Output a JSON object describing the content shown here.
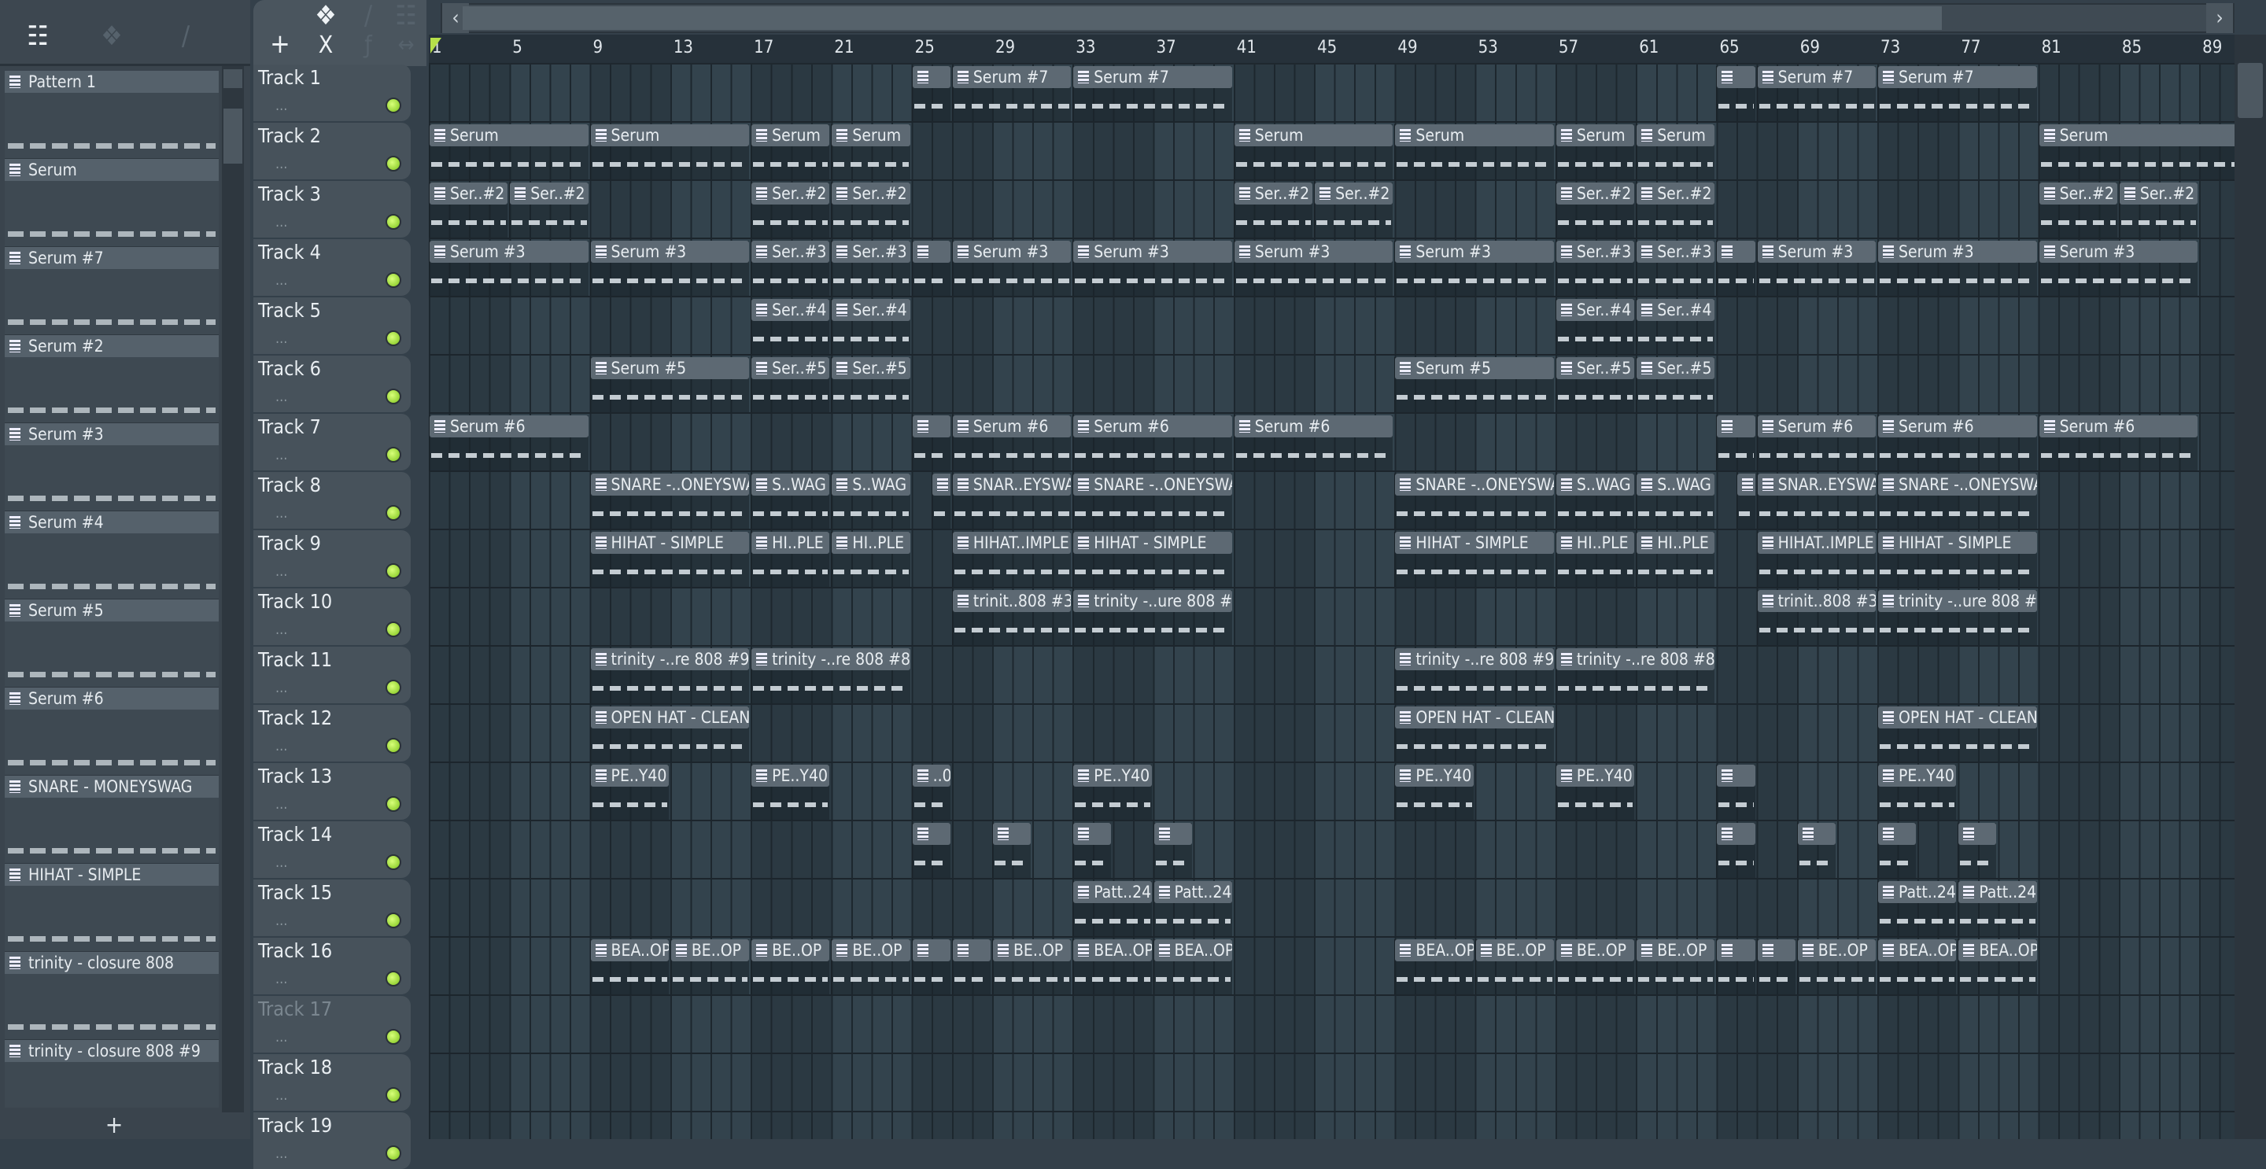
{
  "left_toolbar": {
    "icons": [
      "piano-roll-icon",
      "audio-wave-icon",
      "automation-icon"
    ]
  },
  "pattern_list": {
    "items": [
      "Pattern 1",
      "Serum",
      "Serum #7",
      "Serum #2",
      "Serum #3",
      "Serum #4",
      "Serum #5",
      "Serum #6",
      "SNARE - MONEYSWAG",
      "HIHAT - SIMPLE",
      "trinity - closure 808",
      "trinity - closure 808 #9"
    ],
    "add_label": "+"
  },
  "playlist_toolbar": {
    "add_label": "+",
    "x_label": "X",
    "f_label": "ƒ"
  },
  "ruler": {
    "bars": [
      "1",
      "5",
      "9",
      "13",
      "17",
      "21",
      "25",
      "29",
      "33",
      "37",
      "41",
      "45",
      "49",
      "53",
      "57",
      "61",
      "65",
      "69",
      "73",
      "77",
      "81",
      "85",
      "89"
    ]
  },
  "tracks": [
    {
      "name": "Track 1",
      "clips": [
        [
          25,
          2,
          ""
        ],
        [
          27,
          6,
          "Serum #7"
        ],
        [
          33,
          8,
          "Serum #7"
        ],
        [
          65,
          2,
          ""
        ],
        [
          67,
          6,
          "Serum #7"
        ],
        [
          73,
          8,
          "Serum #7"
        ]
      ]
    },
    {
      "name": "Track 2",
      "clips": [
        [
          1,
          8,
          "Serum"
        ],
        [
          9,
          8,
          "Serum"
        ],
        [
          17,
          4,
          "Serum"
        ],
        [
          21,
          4,
          "Serum"
        ],
        [
          41,
          8,
          "Serum"
        ],
        [
          49,
          8,
          "Serum"
        ],
        [
          57,
          4,
          "Serum"
        ],
        [
          61,
          4,
          "Serum"
        ],
        [
          81,
          10,
          "Serum"
        ]
      ]
    },
    {
      "name": "Track 3",
      "clips": [
        [
          1,
          4,
          "Ser..#2"
        ],
        [
          5,
          4,
          "Ser..#2"
        ],
        [
          17,
          4,
          "Ser..#2"
        ],
        [
          21,
          4,
          "Ser..#2"
        ],
        [
          41,
          4,
          "Ser..#2"
        ],
        [
          45,
          4,
          "Ser..#2"
        ],
        [
          57,
          4,
          "Ser..#2"
        ],
        [
          61,
          4,
          "Ser..#2"
        ],
        [
          81,
          4,
          "Ser..#2"
        ],
        [
          85,
          4,
          "Ser..#2"
        ]
      ]
    },
    {
      "name": "Track 4",
      "clips": [
        [
          1,
          8,
          "Serum #3"
        ],
        [
          9,
          8,
          "Serum #3"
        ],
        [
          17,
          4,
          "Ser..#3"
        ],
        [
          21,
          4,
          "Ser..#3"
        ],
        [
          25,
          2,
          ""
        ],
        [
          27,
          6,
          "Serum #3"
        ],
        [
          33,
          8,
          "Serum #3"
        ],
        [
          41,
          8,
          "Serum #3"
        ],
        [
          49,
          8,
          "Serum #3"
        ],
        [
          57,
          4,
          "Ser..#3"
        ],
        [
          61,
          4,
          "Ser..#3"
        ],
        [
          65,
          2,
          ""
        ],
        [
          67,
          6,
          "Serum #3"
        ],
        [
          73,
          8,
          "Serum #3"
        ],
        [
          81,
          8,
          "Serum #3"
        ]
      ]
    },
    {
      "name": "Track 5",
      "clips": [
        [
          17,
          4,
          "Ser..#4"
        ],
        [
          21,
          4,
          "Ser..#4"
        ],
        [
          57,
          4,
          "Ser..#4"
        ],
        [
          61,
          4,
          "Ser..#4"
        ]
      ]
    },
    {
      "name": "Track 6",
      "clips": [
        [
          9,
          8,
          "Serum #5"
        ],
        [
          17,
          4,
          "Ser..#5"
        ],
        [
          21,
          4,
          "Ser..#5"
        ],
        [
          49,
          8,
          "Serum #5"
        ],
        [
          57,
          4,
          "Ser..#5"
        ],
        [
          61,
          4,
          "Ser..#5"
        ]
      ]
    },
    {
      "name": "Track 7",
      "clips": [
        [
          1,
          8,
          "Serum #6"
        ],
        [
          25,
          2,
          ""
        ],
        [
          27,
          6,
          "Serum #6"
        ],
        [
          33,
          8,
          "Serum #6"
        ],
        [
          41,
          8,
          "Serum #6"
        ],
        [
          65,
          2,
          ""
        ],
        [
          67,
          6,
          "Serum #6"
        ],
        [
          73,
          8,
          "Serum #6"
        ],
        [
          81,
          8,
          "Serum #6"
        ]
      ]
    },
    {
      "name": "Track 8",
      "clips": [
        [
          9,
          8,
          "SNARE -..ONEYSWAG"
        ],
        [
          17,
          4,
          "S..WAG"
        ],
        [
          21,
          4,
          "S..WAG"
        ],
        [
          26,
          1,
          ""
        ],
        [
          27,
          6,
          "SNAR..EYSWAG"
        ],
        [
          33,
          8,
          "SNARE -..ONEYSWAG"
        ],
        [
          49,
          8,
          "SNARE -..ONEYSWAG"
        ],
        [
          57,
          4,
          "S..WAG"
        ],
        [
          61,
          4,
          "S..WAG"
        ],
        [
          66,
          1,
          ""
        ],
        [
          67,
          6,
          "SNAR..EYSWAG"
        ],
        [
          73,
          8,
          "SNARE -..ONEYSWAG"
        ]
      ]
    },
    {
      "name": "Track 9",
      "clips": [
        [
          9,
          8,
          "HIHAT - SIMPLE"
        ],
        [
          17,
          4,
          "HI..PLE"
        ],
        [
          21,
          4,
          "HI..PLE"
        ],
        [
          27,
          6,
          "HIHAT..IMPLE"
        ],
        [
          33,
          8,
          "HIHAT - SIMPLE"
        ],
        [
          49,
          8,
          "HIHAT - SIMPLE"
        ],
        [
          57,
          4,
          "HI..PLE"
        ],
        [
          61,
          4,
          "HI..PLE"
        ],
        [
          67,
          6,
          "HIHAT..IMPLE"
        ],
        [
          73,
          8,
          "HIHAT - SIMPLE"
        ]
      ]
    },
    {
      "name": "Track 10",
      "clips": [
        [
          27,
          6,
          "trinit..808 #3"
        ],
        [
          33,
          8,
          "trinity -..ure 808 #7"
        ],
        [
          67,
          6,
          "trinit..808 #3"
        ],
        [
          73,
          8,
          "trinity -..ure 808 #7"
        ]
      ]
    },
    {
      "name": "Track 11",
      "clips": [
        [
          9,
          8,
          "trinity -..re 808 #9"
        ],
        [
          17,
          8,
          "trinity -..re 808 #8"
        ],
        [
          49,
          8,
          "trinity -..re 808 #9"
        ],
        [
          57,
          8,
          "trinity -..re 808 #8"
        ]
      ]
    },
    {
      "name": "Track 12",
      "clips": [
        [
          9,
          8,
          "OPEN HAT - CLEAN"
        ],
        [
          49,
          8,
          "OPEN HAT - CLEAN"
        ],
        [
          73,
          8,
          "OPEN HAT - CLEAN"
        ]
      ]
    },
    {
      "name": "Track 13",
      "clips": [
        [
          9,
          4,
          "PE..Y40"
        ],
        [
          17,
          4,
          "PE..Y40"
        ],
        [
          25,
          2,
          "..0"
        ],
        [
          33,
          4,
          "PE..Y40"
        ],
        [
          49,
          4,
          "PE..Y40"
        ],
        [
          57,
          4,
          "PE..Y40"
        ],
        [
          65,
          2,
          ""
        ],
        [
          73,
          4,
          "PE..Y40"
        ]
      ]
    },
    {
      "name": "Track 14",
      "clips": [
        [
          25,
          2,
          ""
        ],
        [
          29,
          2,
          ""
        ],
        [
          33,
          2,
          ""
        ],
        [
          37,
          2,
          ""
        ],
        [
          65,
          2,
          ""
        ],
        [
          69,
          2,
          ""
        ],
        [
          73,
          2,
          ""
        ],
        [
          77,
          2,
          ""
        ]
      ]
    },
    {
      "name": "Track 15",
      "clips": [
        [
          33,
          4,
          "Patt..24"
        ],
        [
          37,
          4,
          "Patt..24"
        ],
        [
          73,
          4,
          "Patt..24"
        ],
        [
          77,
          4,
          "Patt..24"
        ]
      ]
    },
    {
      "name": "Track 16",
      "clips": [
        [
          9,
          4,
          "BEA..OP"
        ],
        [
          13,
          4,
          "BE..OP"
        ],
        [
          17,
          4,
          "BE..OP"
        ],
        [
          21,
          4,
          "BE..OP"
        ],
        [
          25,
          2,
          ""
        ],
        [
          27,
          2,
          ""
        ],
        [
          29,
          4,
          "BE..OP"
        ],
        [
          33,
          4,
          "BEA..OP"
        ],
        [
          37,
          4,
          "BEA..OP"
        ],
        [
          49,
          4,
          "BEA..OP"
        ],
        [
          53,
          4,
          "BE..OP"
        ],
        [
          57,
          4,
          "BE..OP"
        ],
        [
          61,
          4,
          "BE..OP"
        ],
        [
          65,
          2,
          ""
        ],
        [
          67,
          2,
          ""
        ],
        [
          69,
          4,
          "BE..OP"
        ],
        [
          73,
          4,
          "BEA..OP"
        ],
        [
          77,
          4,
          "BEA..OP"
        ]
      ]
    },
    {
      "name": "Track 17",
      "clips": [],
      "muted": true
    },
    {
      "name": "Track 18",
      "clips": []
    },
    {
      "name": "Track 19",
      "clips": []
    }
  ],
  "track_dots": "...",
  "overview": {
    "left_arrow": "‹",
    "right_arrow": "›"
  },
  "colors": {
    "accent_led": "#7cc21a",
    "clip_header": "#5d6973",
    "playhead": "#b6e04a"
  }
}
